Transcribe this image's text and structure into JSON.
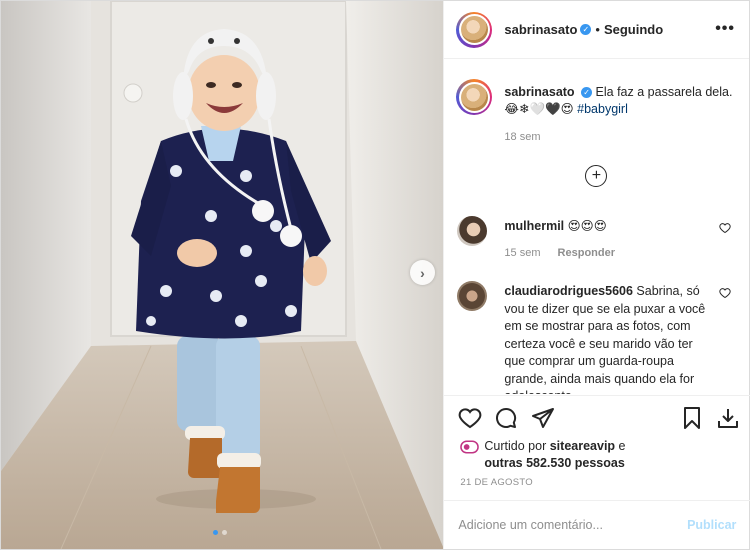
{
  "post": {
    "username": "sabrinasato",
    "verified_icon": "verified-badge-icon",
    "separator": "•",
    "follow_status": "Seguindo",
    "more_icon": "more-options-icon",
    "caption": {
      "text": "Ela faz a passarela dela.",
      "emoji_line": "😂❄🤍🖤😍",
      "hashtag": "#babygirl",
      "time": "18 sem"
    },
    "load_more_icon": "plus-circle-icon"
  },
  "comments": [
    {
      "username": "mulhermil",
      "text": "😍😍😍",
      "time": "15 sem",
      "reply": "Responder"
    },
    {
      "username": "claudiarodrigues5606",
      "text": "Sabrina, só vou te dizer que se ela puxar a você em se mostrar para as fotos, com certeza você e seu marido vão ter que comprar um guarda-roupa grande, ainda mais quando ela for adolescente"
    }
  ],
  "actions": {
    "like_icon": "heart-icon",
    "comment_icon": "comment-icon",
    "share_icon": "share-icon",
    "save_icon": "bookmark-icon",
    "download_icon": "download-icon"
  },
  "likes": {
    "prefix": "Curtido por",
    "user": "siteareavip",
    "mid": "e",
    "others": "outras 582.530 pessoas"
  },
  "date": "21 DE AGOSTO",
  "add_comment": {
    "placeholder": "Adicione um comentário...",
    "publish": "Publicar"
  },
  "carousel": {
    "next_icon": "chevron-right-icon",
    "slides": 2,
    "active": 1
  },
  "colors": {
    "accent": "#3897f0",
    "publish_disabled": "#b2dffc",
    "hashtag": "#00376b",
    "muted": "#8e8e8e"
  }
}
